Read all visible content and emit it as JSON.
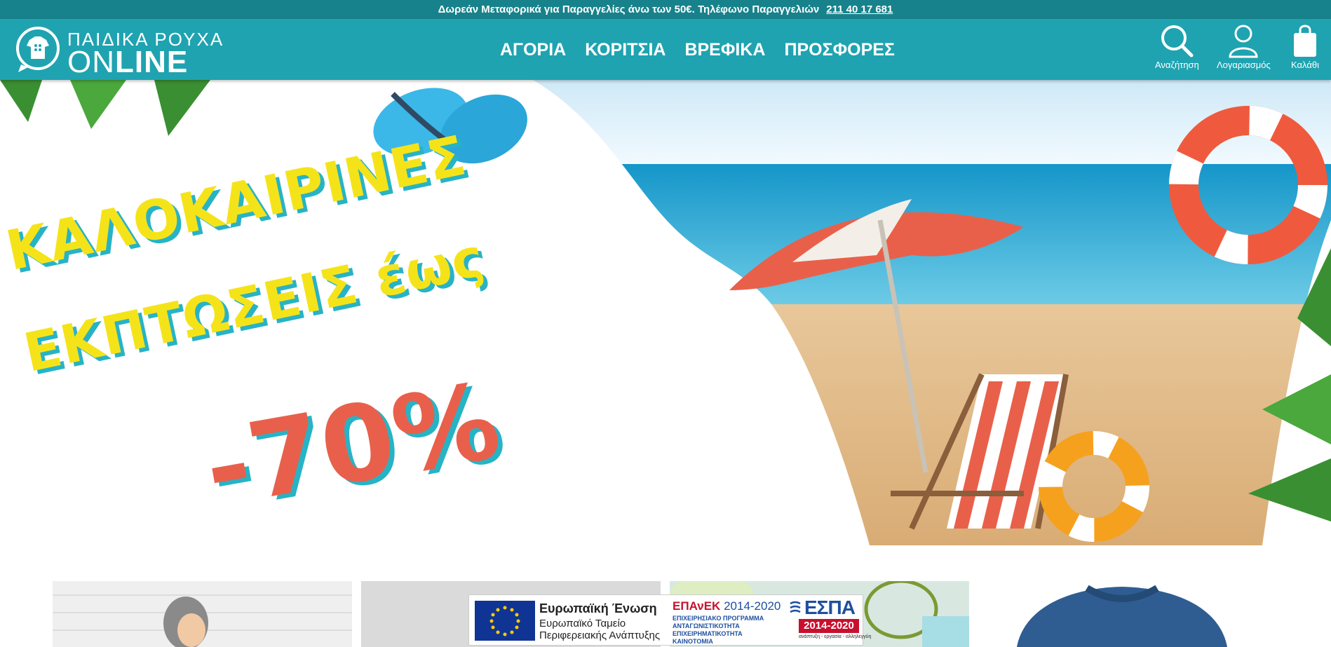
{
  "topbar": {
    "text": "Δωρεάν Μεταφορικά για Παραγγελίες άνω των 50€. Τηλέφωνο Παραγγελιών",
    "phone": "211 40 17 681"
  },
  "header": {
    "logo_line1": "ΠΑΙΔΙΚΑ ΡΟΥΧΑ",
    "logo_line2_a": "ON",
    "logo_line2_b": "LINE",
    "nav": [
      "ΑΓΟΡΙΑ",
      "ΚΟΡΙΤΣΙΑ",
      "ΒΡΕΦΙΚΑ",
      "ΠΡΟΣΦΟΡΕΣ"
    ],
    "icons": {
      "search_label": "Αναζήτηση",
      "account_label": "Λογαριασμός",
      "cart_label": "Καλάθι"
    }
  },
  "hero": {
    "line1": "ΚΑΛΟΚΑΙΡΙΝΕΣ",
    "line2": "ΕΚΠΤΩΣΕΙΣ έως",
    "discount": "-70%"
  },
  "eu_banner": {
    "eu_title": "Ευρωπαϊκή Ένωση",
    "eu_sub1": "Ευρωπαϊκό Ταμείο",
    "eu_sub2": "Περιφερειακής Ανάπτυξης",
    "epanek": "ΕΠΑνΕΚ",
    "epanek_years": "2014-2020",
    "epanek_lines": [
      "ΕΠΙΧΕΙΡΗΣΙΑΚΟ ΠΡΟΓΡΑΜΜΑ",
      "ΑΝΤΑΓΩΝΙΣΤΙΚΟΤΗΤΑ",
      "ΕΠΙΧΕΙΡΗΜΑΤΙΚΟΤΗΤΑ",
      "ΚΑΙΝΟΤΟΜΙΑ"
    ],
    "espa": "ΕΣΠΑ",
    "espa_years": "2014-2020",
    "espa_sub": "ανάπτυξη - εργασία - αλληλεγγύη"
  },
  "colors": {
    "header": "#1fa3b0",
    "topbar": "#17828b",
    "hero_yellow": "#f5e31a",
    "hero_red": "#e8604b",
    "hero_shadow": "#27b3c6"
  }
}
